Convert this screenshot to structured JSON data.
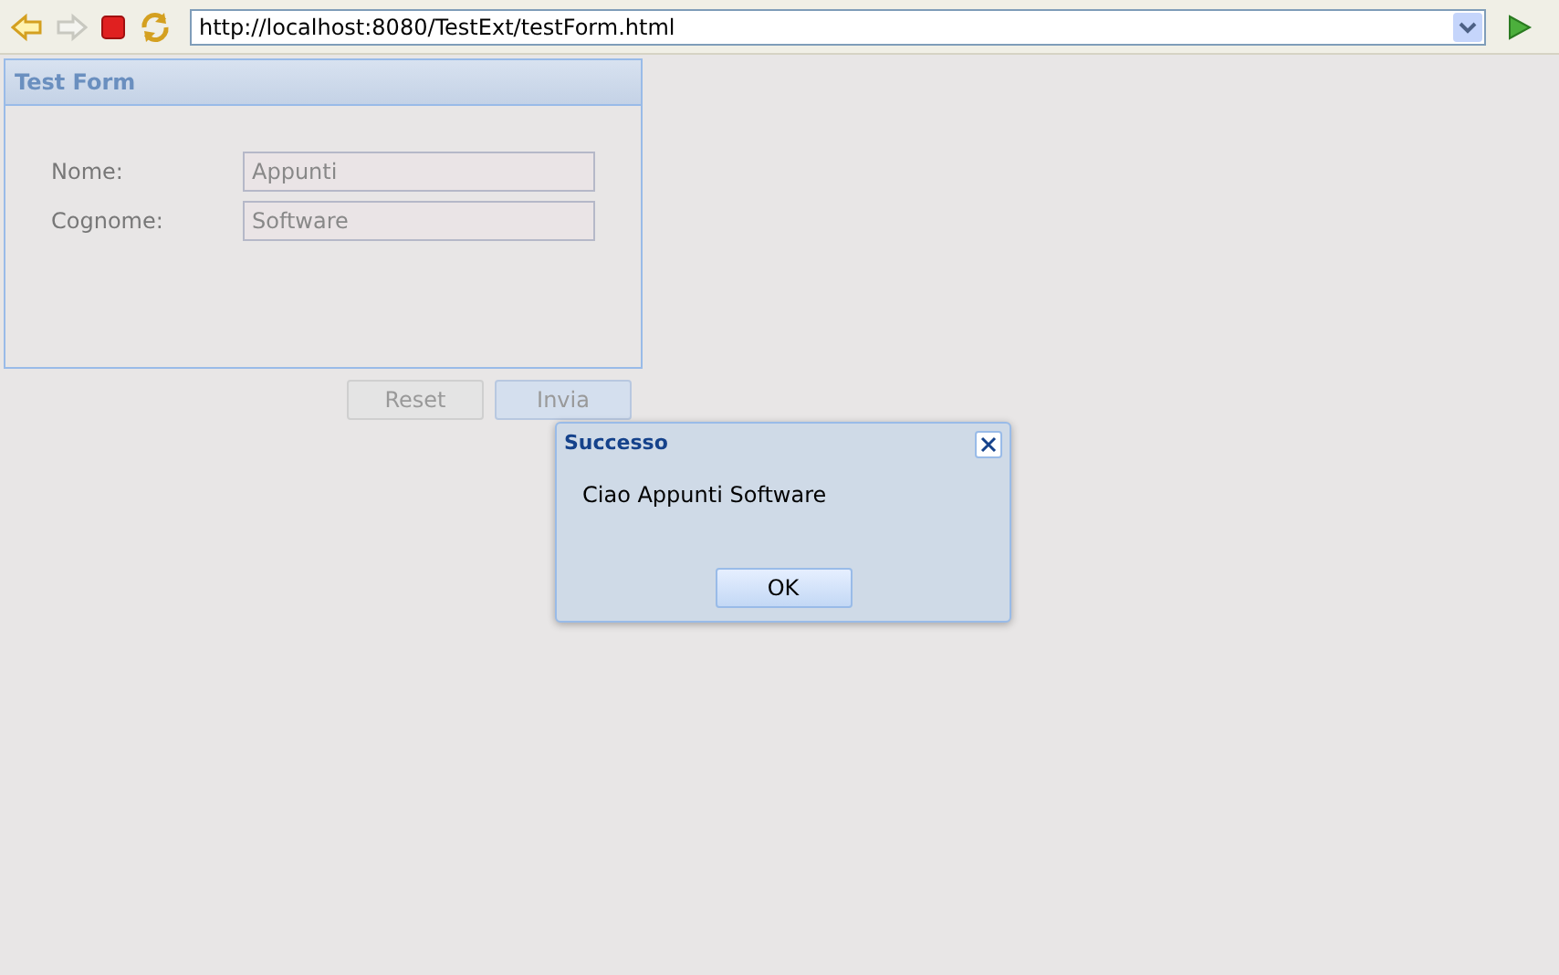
{
  "browser": {
    "url": "http://localhost:8080/TestExt/testForm.html"
  },
  "form": {
    "title": "Test Form",
    "fields": [
      {
        "label": "Nome:",
        "value": "Appunti"
      },
      {
        "label": "Cognome:",
        "value": "Software"
      }
    ],
    "buttons": [
      {
        "label": "Reset"
      },
      {
        "label": "Invia"
      }
    ]
  },
  "dialog": {
    "title": "Successo",
    "message": "Ciao Appunti Software",
    "button": "OK"
  }
}
